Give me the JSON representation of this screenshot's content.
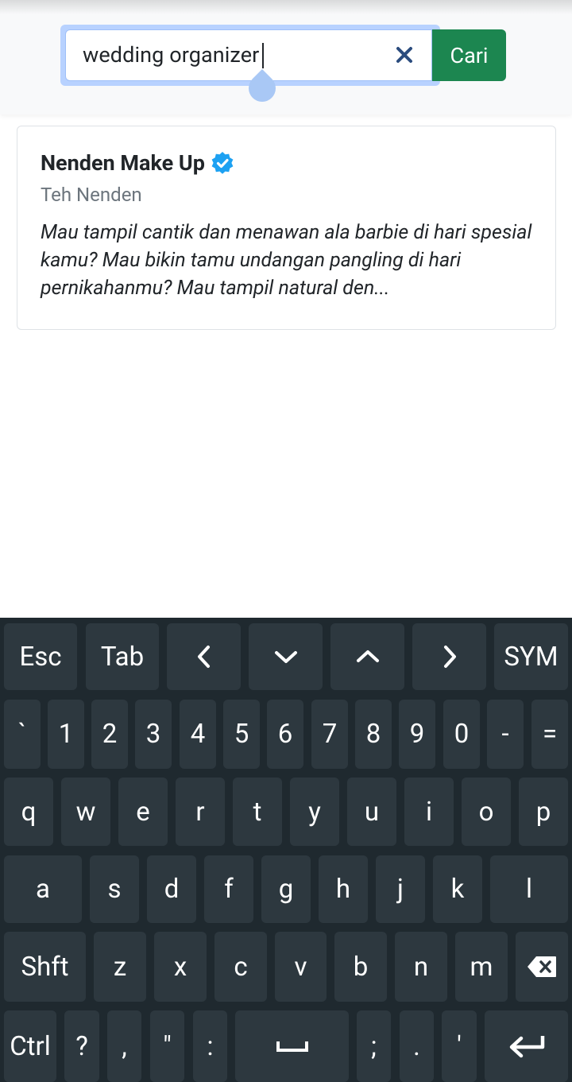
{
  "search": {
    "value": "wedding organizer",
    "clear_icon": "close-icon",
    "submit_label": "Cari"
  },
  "result": {
    "title": "Nenden Make Up",
    "verified_icon": "verified-badge-icon",
    "subtitle": "Teh Nenden",
    "description": "Mau tampil cantik dan menawan ala barbie di hari spesial kamu? Mau bikin tamu undangan pangling di hari pernikahanmu? Mau tampil natural den..."
  },
  "colors": {
    "accent": "#1c8650",
    "verified": "#1da1f2",
    "keyboard_bg": "#1f292f",
    "key_bg": "#2d383f"
  },
  "keyboard": {
    "row0": [
      "Esc",
      "Tab",
      "left-arrow-icon",
      "down-arrow-icon",
      "up-arrow-icon",
      "right-arrow-icon",
      "SYM"
    ],
    "row1": [
      "`",
      "1",
      "2",
      "3",
      "4",
      "5",
      "6",
      "7",
      "8",
      "9",
      "0",
      "-",
      "="
    ],
    "row2": [
      "q",
      "w",
      "e",
      "r",
      "t",
      "y",
      "u",
      "i",
      "o",
      "p"
    ],
    "row3": [
      "a",
      "s",
      "d",
      "f",
      "g",
      "h",
      "j",
      "k",
      "l"
    ],
    "row4": [
      "Shft",
      "z",
      "x",
      "c",
      "v",
      "b",
      "n",
      "m",
      "backspace-icon"
    ],
    "row5": [
      "Ctrl",
      "?",
      ",",
      "\"",
      ":",
      "space-icon",
      ";",
      ".",
      "'",
      "enter-icon"
    ]
  }
}
